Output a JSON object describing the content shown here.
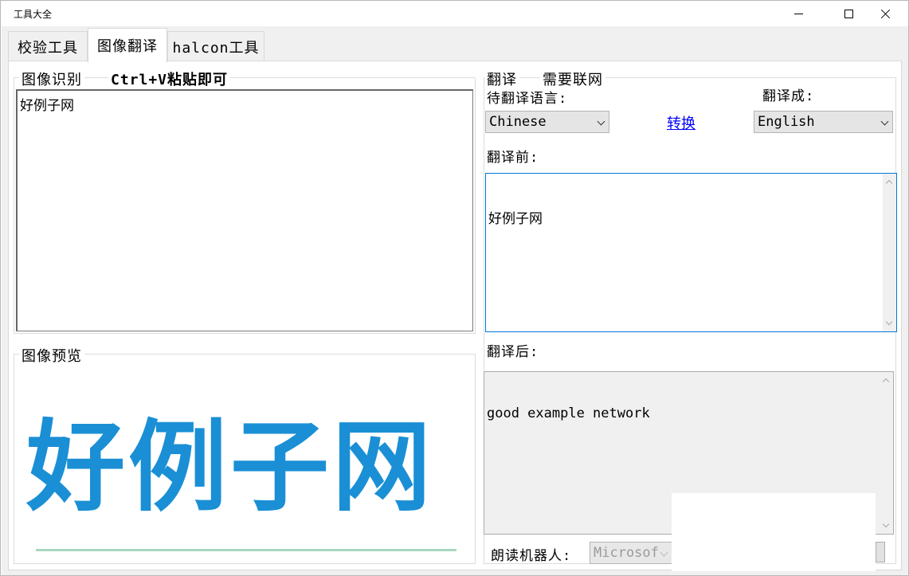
{
  "window": {
    "title": "工具大全"
  },
  "tabs": [
    {
      "label": "校验工具",
      "active": false
    },
    {
      "label": "图像翻译",
      "active": true
    },
    {
      "label": "halcon工具",
      "active": false
    }
  ],
  "ocr": {
    "caption": "图像识别",
    "hint": "Ctrl+V粘贴即可",
    "text": "好例子网"
  },
  "preview": {
    "caption": "图像预览",
    "image_text": "好例子网"
  },
  "translate": {
    "caption": "翻译",
    "network_note": "需要联网",
    "source_lang_label": "待翻译语言:",
    "source_lang_value": "Chinese",
    "swap_link": "转换",
    "target_lang_label": "翻译成:",
    "target_lang_value": "English",
    "before_label": "翻译前:",
    "before_text": "好例子网",
    "after_label": "翻译后:",
    "after_text": "good example network",
    "reader_label": "朗读机器人:",
    "reader_value": "Microsof"
  },
  "colors": {
    "logo": "#1a8fd5",
    "focus_border": "#0078d7",
    "link": "#0000ff"
  }
}
